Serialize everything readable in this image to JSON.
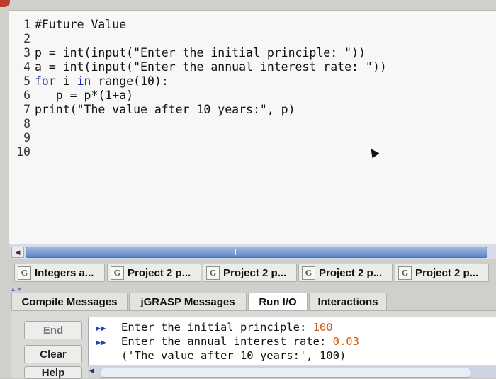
{
  "editor": {
    "lines": [
      {
        "num": "1",
        "code": "#Future Value"
      },
      {
        "num": "2",
        "code": ""
      },
      {
        "num": "3",
        "code": "p = int(input(\"Enter the initial principle: \"))"
      },
      {
        "num": "4",
        "code": "a = int(input(\"Enter the annual interest rate: \"))"
      },
      {
        "num": "5",
        "code_kw": "for",
        "code_mid": " i ",
        "code_kw2": "in",
        "code_rest": " range(10):"
      },
      {
        "num": "6",
        "code": "   p = p*(1+a)"
      },
      {
        "num": "7",
        "code": "print(\"The value after 10 years:\", p)"
      },
      {
        "num": "8",
        "code": ""
      },
      {
        "num": "9",
        "code": ""
      },
      {
        "num": "10",
        "code": ""
      }
    ]
  },
  "project_tabs": [
    {
      "label": "Integers a...",
      "icon": "grasp-file-icon"
    },
    {
      "label": "Project 2 p...",
      "icon": "grasp-file-icon"
    },
    {
      "label": "Project 2 p...",
      "icon": "grasp-file-icon"
    },
    {
      "label": "Project 2 p...",
      "icon": "grasp-file-icon"
    },
    {
      "label": "Project 2 p...",
      "icon": "grasp-file-icon"
    }
  ],
  "bottom_tabs": [
    {
      "label": "Compile Messages"
    },
    {
      "label": "jGRASP Messages"
    },
    {
      "label": "Run I/O"
    },
    {
      "label": "Interactions"
    }
  ],
  "side_buttons": {
    "end": "End",
    "clear": "Clear",
    "help": "Help"
  },
  "console": {
    "prompt_marker": "▶▶",
    "line1_text": "Enter the initial principle: ",
    "line1_input": "100",
    "line2_text": "Enter the annual interest rate: ",
    "line2_input": "0.03",
    "line3_text": "('The value after 10 years:', 100)"
  },
  "colors": {
    "keyword": "#1f2bb0",
    "user_input": "#c85a13",
    "prompt": "#2a3db6"
  }
}
